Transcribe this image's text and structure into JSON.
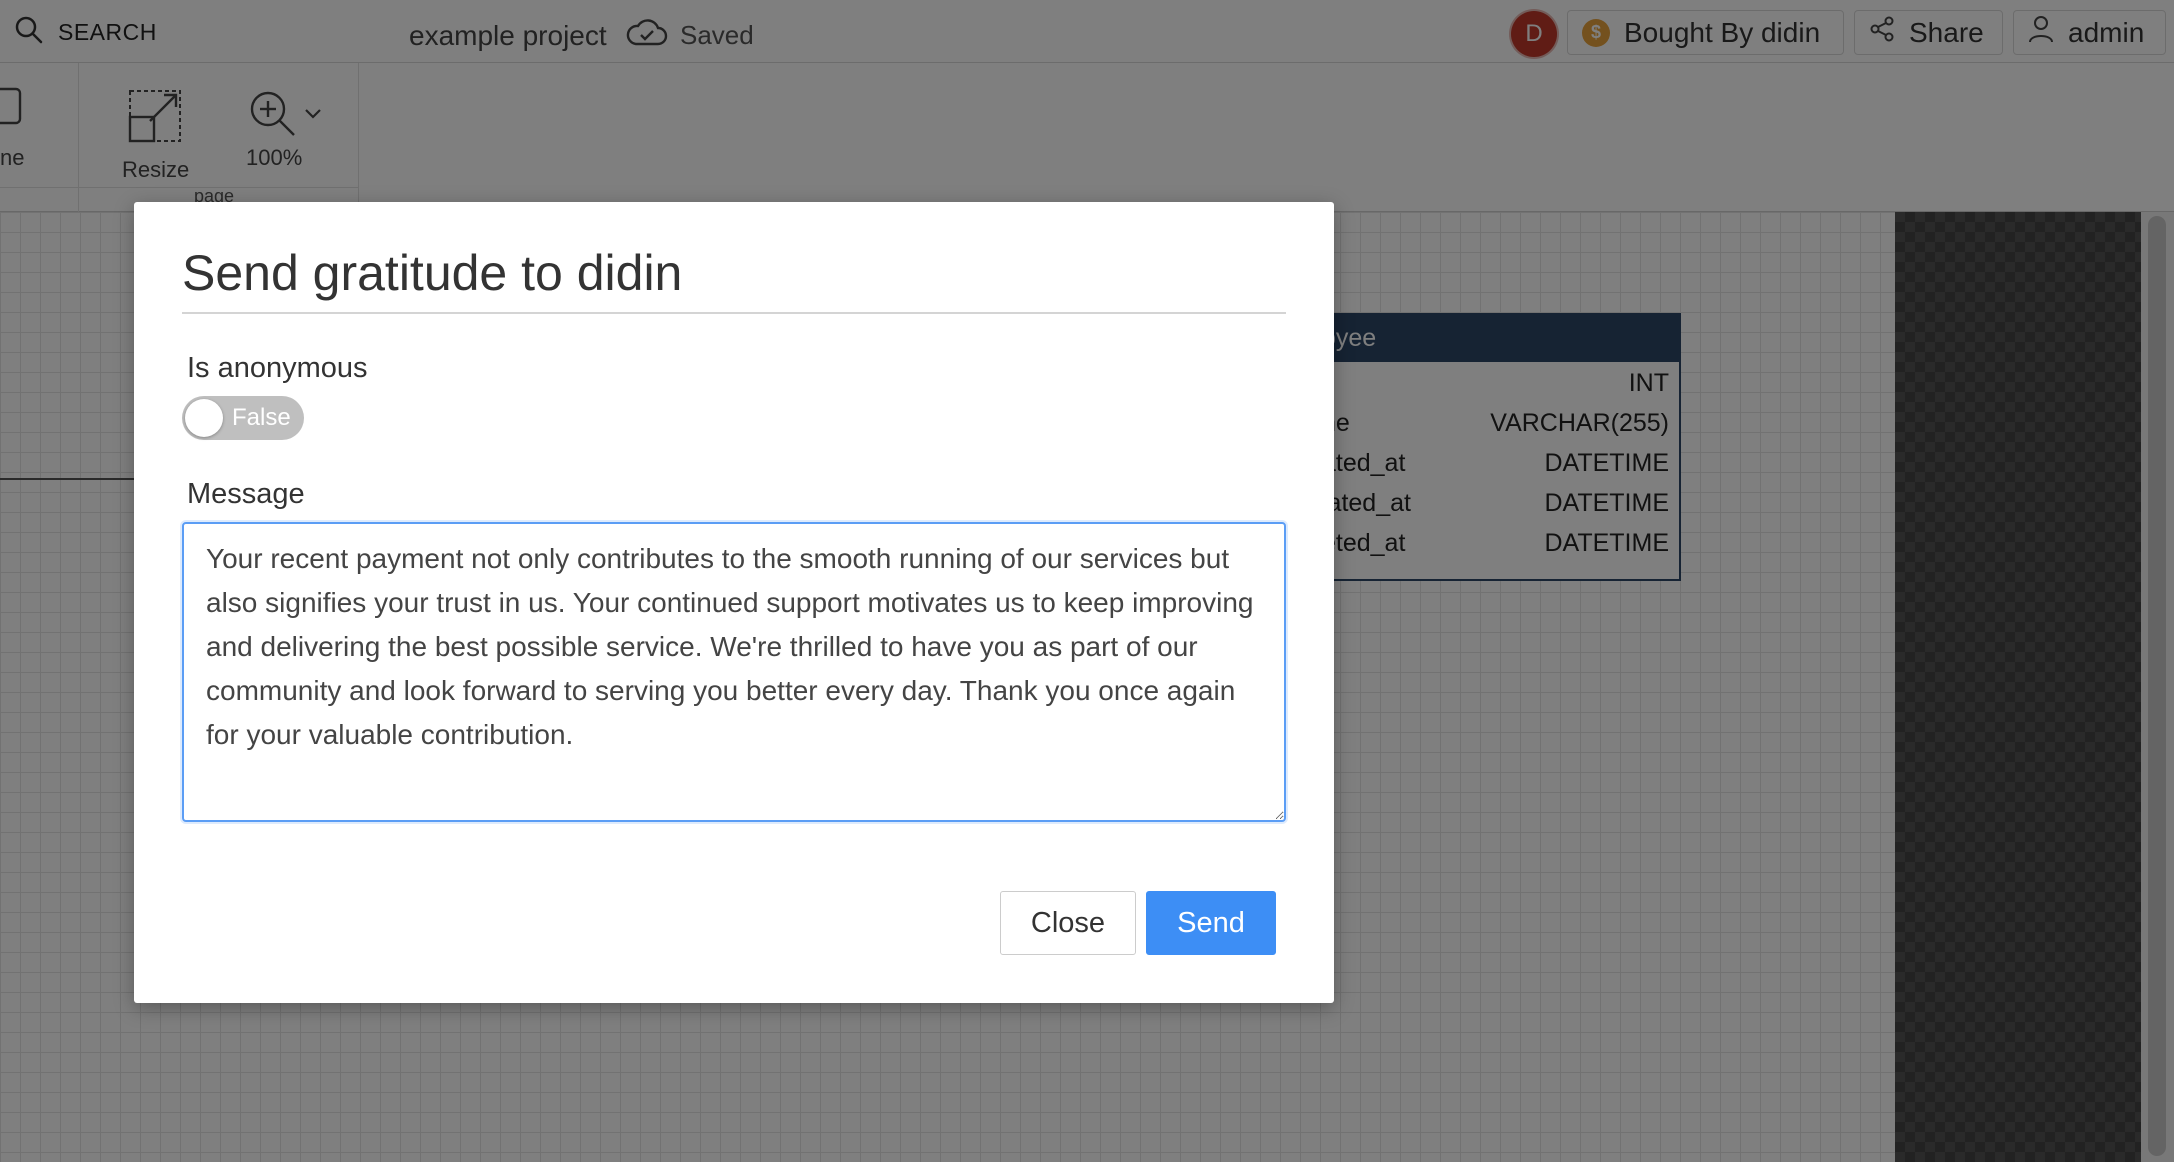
{
  "header": {
    "search_label": "SEARCH",
    "project_name": "example project",
    "save_status": "Saved",
    "avatar_initial": "D",
    "bought_by_label": "Bought By didin",
    "share_label": "Share",
    "user_label": "admin"
  },
  "toolbar": {
    "partial_tool_label": "ne",
    "resize_label": "Resize",
    "zoom_label": "100%",
    "group_label": "page"
  },
  "er_table": {
    "title": "oyee",
    "rows": [
      {
        "column": "",
        "type": "INT"
      },
      {
        "column": "ne",
        "type": "VARCHAR(255)"
      },
      {
        "column": "ated_at",
        "type": "DATETIME"
      },
      {
        "column": "lated_at",
        "type": "DATETIME"
      },
      {
        "column": "eted_at",
        "type": "DATETIME"
      }
    ]
  },
  "modal": {
    "title": "Send gratitude to didin",
    "anonymous_label": "Is anonymous",
    "anonymous_value": "False",
    "message_label": "Message",
    "message_value": "Your recent payment not only contributes to the smooth running of our services but also signifies your trust in us. Your continued support motivates us to keep improving and delivering the best possible service. We're thrilled to have you as part of our community and look forward to serving you better every day. Thank you once again for your valuable contribution.",
    "close_label": "Close",
    "send_label": "Send"
  },
  "colors": {
    "primary": "#3d8ef5",
    "table_header": "#2c4766",
    "avatar": "#c0392b",
    "coin": "#e8a33c"
  }
}
